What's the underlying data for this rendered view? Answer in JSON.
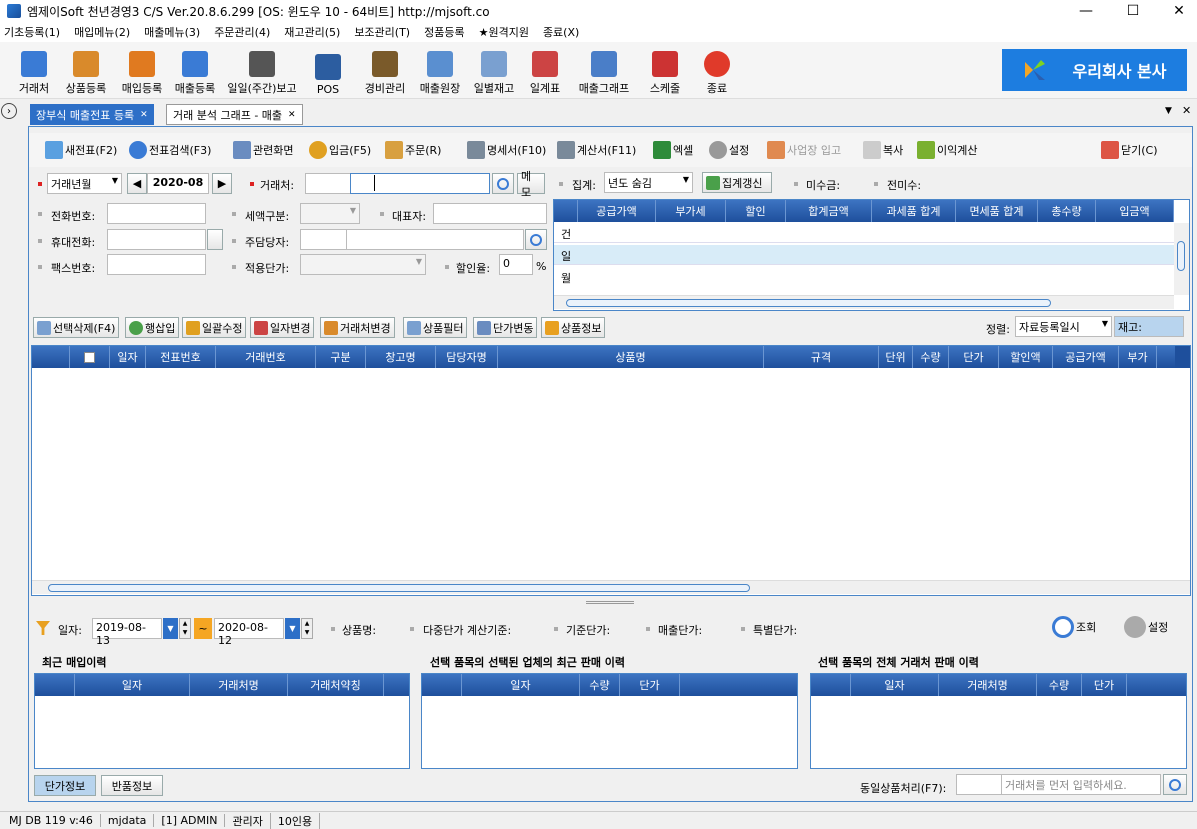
{
  "window": {
    "title": "엠제이Soft 천년경영3 C/S  Ver.20.8.6.299  [OS: 윈도우 10 - 64비트]   http://mjsoft.co",
    "min": "—",
    "max": "☐",
    "close": "✕"
  },
  "menu": [
    "기초등록(1)",
    "매입메뉴(2)",
    "매출메뉴(3)",
    "주문관리(4)",
    "재고관리(5)",
    "보조관리(T)",
    "정품등록",
    "★원격지원",
    "종료(X)"
  ],
  "toolbar": [
    {
      "label": "거래처",
      "color": "#3a7bd5"
    },
    {
      "label": "상품등록",
      "color": "#d98a2b"
    },
    {
      "label": "매입등록",
      "color": "#e07a20"
    },
    {
      "label": "매출등록",
      "color": "#3a7bd5"
    },
    {
      "label": "일일(주간)보고",
      "color": "#555"
    },
    {
      "label": "POS",
      "color": "#2c5da0"
    },
    {
      "label": "경비관리",
      "color": "#7a5a2a"
    },
    {
      "label": "매출원장",
      "color": "#5a8fd0"
    },
    {
      "label": "일별재고",
      "color": "#7aa0d0"
    },
    {
      "label": "일계표",
      "color": "#c44"
    },
    {
      "label": "매출그래프",
      "color": "#4a7ec8"
    },
    {
      "label": "스케줄",
      "color": "#c33"
    },
    {
      "label": "종료",
      "color": "#e03a2a"
    }
  ],
  "brand": "우리회사 본사",
  "doc_tabs": [
    "장부식 매출전표 등록",
    "거래 분석 그래프 - 매출"
  ],
  "actions": [
    "새전표(F2)",
    "전표검색(F3)",
    "관련화면",
    "입금(F5)",
    "주문(R)",
    "명세서(F10)",
    "계산서(F11)",
    "엑셀",
    "설정",
    "사업장 입고",
    "복사",
    "이익계산",
    "닫기(C)"
  ],
  "form": {
    "period_label": "거래년월",
    "period": "2020-08",
    "client_label": "거래처:",
    "memo": "메모",
    "phone_label": "전화번호:",
    "tax_label": "세액구분:",
    "ceo_label": "대표자:",
    "mobile_label": "휴대전화:",
    "manager_label": "주담당자:",
    "fax_label": "팩스번호:",
    "price_label": "적용단가:",
    "discount_label": "할인율:",
    "discount_value": "0",
    "percent": "%"
  },
  "summary": {
    "agg_label": "집계:",
    "agg_value": "년도 숨김",
    "refresh": "집계갱신",
    "unpaid_label": "미수금:",
    "prev_unpaid_label": "전미수:",
    "columns": [
      "공급가액",
      "부가세",
      "할인",
      "합계금액",
      "과세품 합계",
      "면세품 합계",
      "총수량",
      "입금액"
    ],
    "rows": [
      "건",
      "일",
      "월"
    ]
  },
  "line_actions": [
    "선택삭제(F4)",
    "행삽입",
    "일괄수정",
    "일자변경",
    "거래처변경",
    "상품필터",
    "단가변동",
    "상품정보"
  ],
  "sort": {
    "label": "정렬:",
    "value": "자료등록일시",
    "stock": "재고:"
  },
  "main_columns": [
    "",
    "일자",
    "전표번호",
    "거래번호",
    "구분",
    "창고명",
    "담당자명",
    "상품명",
    "규격",
    "단위",
    "수량",
    "단가",
    "할인액",
    "공급가액",
    "부가"
  ],
  "history": {
    "date_label": "일자:",
    "from": "2019-08-13",
    "to": "2020-08-12",
    "product_label": "상품명:",
    "multi_label": "다중단가 계산기준:",
    "base_label": "기준단가:",
    "sale_price_label": "매출단가:",
    "special_label": "특별단가:",
    "search": "조회",
    "settings": "설정",
    "panel1": {
      "title": "최근 매입이력",
      "columns": [
        "일자",
        "거래처명",
        "거래처약칭"
      ]
    },
    "panel2": {
      "title": "선택 품목의 선택된 업체의 최근 판매 이력",
      "columns": [
        "일자",
        "수량",
        "단가"
      ]
    },
    "panel3": {
      "title": "선택 품목의 전체 거래처 판매 이력",
      "columns": [
        "일자",
        "거래처명",
        "수량",
        "단가"
      ]
    }
  },
  "bottom": {
    "tab1": "단가정보",
    "tab2": "반품정보",
    "same_label": "동일상품처리(F7):",
    "placeholder": "거래처를 먼저 입력하세요."
  },
  "status": [
    "MJ DB 119 v:46",
    "mjdata",
    "[1] ADMIN",
    "관리자",
    "10인용"
  ]
}
